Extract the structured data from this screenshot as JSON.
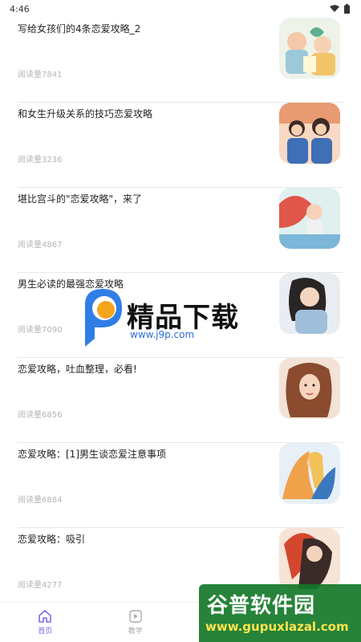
{
  "status_bar": {
    "time": "4:46"
  },
  "articles": [
    {
      "title": "写给女孩们的4条恋爱攻略_2",
      "reads": "阅读量7841"
    },
    {
      "title": "和女生升级关系的技巧恋爱攻略",
      "reads": "阅读量3236"
    },
    {
      "title": "堪比宫斗的\"恋爱攻略\"，来了",
      "reads": "阅读量4867"
    },
    {
      "title": "男生必读的最强恋爱攻略",
      "reads": "阅读量7090"
    },
    {
      "title": "恋爱攻略，吐血整理，必看!",
      "reads": "阅读量6856"
    },
    {
      "title": "恋爱攻略：[1]男生谈恋爱注意事项",
      "reads": "阅读量6884"
    },
    {
      "title": "恋爱攻略：吸引",
      "reads": "阅读量4277"
    }
  ],
  "bottom_nav": [
    {
      "label": "首页",
      "icon": "home-icon",
      "active": true
    },
    {
      "label": "教学",
      "icon": "play-icon",
      "active": false
    }
  ],
  "watermarks": {
    "center_title": "精品下载",
    "center_url": "www.j9p.com",
    "corner_title": "谷普软件园",
    "corner_url": "www.gupuxlazal.com"
  },
  "colors": {
    "accent": "#7a6cf0",
    "divider": "#e8e8e8",
    "reads_text": "#b5b5b5"
  }
}
